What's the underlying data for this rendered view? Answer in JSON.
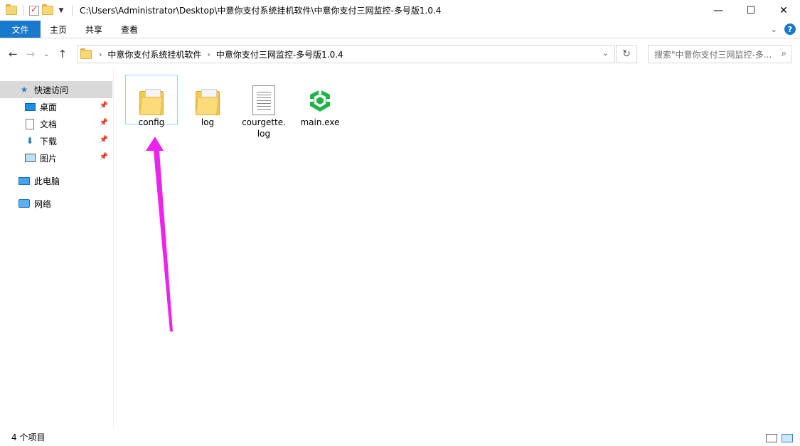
{
  "window": {
    "title": "C:\\Users\\Administrator\\Desktop\\中意你支付系统挂机软件\\中意你支付三网监控-多号版1.0.4",
    "minimize_glyph": "—",
    "maximize_glyph": "☐",
    "close_glyph": "✕"
  },
  "ribbon": {
    "file_tab": "文件",
    "tabs": [
      "主页",
      "共享",
      "查看"
    ],
    "expand_glyph": "⌄",
    "help_glyph": "?"
  },
  "nav": {
    "back_glyph": "←",
    "forward_glyph": "→",
    "recent_glyph": "⌄",
    "up_glyph": "↑"
  },
  "address": {
    "crumbs": [
      "中意你支付系统挂机软件",
      "中意你支付三网监控-多号版1.0.4"
    ],
    "separator": "›",
    "dropdown_glyph": "⌄",
    "refresh_glyph": "↻"
  },
  "search": {
    "placeholder": "搜索\"中意你支付三网监控-多...",
    "icon_glyph": "⌕"
  },
  "sidebar": {
    "quick_access": "快速访问",
    "pinned": [
      {
        "label": "桌面",
        "icon": "desktop-icon"
      },
      {
        "label": "文档",
        "icon": "documents-icon"
      },
      {
        "label": "下载",
        "icon": "downloads-icon"
      },
      {
        "label": "图片",
        "icon": "pictures-icon"
      }
    ],
    "this_pc": "此电脑",
    "network": "网络",
    "pin_glyph": "📌"
  },
  "files": [
    {
      "name": "config",
      "type": "folder",
      "selected": true
    },
    {
      "name": "log",
      "type": "folder",
      "selected": false
    },
    {
      "name": "courgette.\nlog",
      "type": "text",
      "selected": false
    },
    {
      "name": "main.exe",
      "type": "exe",
      "selected": false
    }
  ],
  "status": {
    "item_count": "4 个项目"
  },
  "colors": {
    "accent": "#1979ca",
    "arrow": "#ee22ee",
    "exe_green": "#21b34a"
  }
}
